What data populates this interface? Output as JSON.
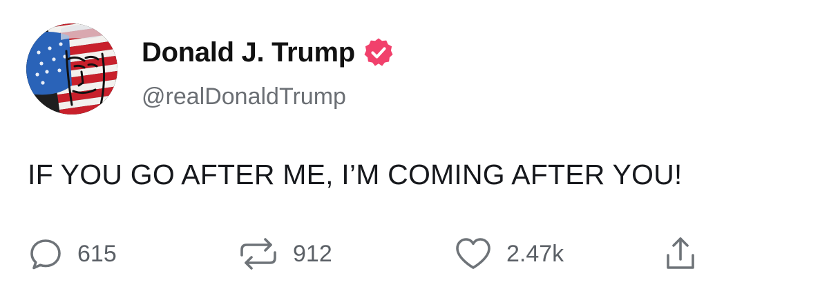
{
  "author": {
    "display_name": "Donald J. Trump",
    "handle": "@realDonaldTrump",
    "verified": true,
    "verified_badge_color": "#f1416c",
    "avatar_icon": "flag-painted-portrait"
  },
  "post": {
    "text": "IF YOU GO AFTER ME, I’M COMING AFTER YOU!"
  },
  "actions": {
    "reply": {
      "icon": "speech-bubble-icon",
      "count": "615"
    },
    "repost": {
      "icon": "repost-arrows-icon",
      "count": "912"
    },
    "like": {
      "icon": "heart-icon",
      "count": "2.47k"
    },
    "share": {
      "icon": "share-upload-icon"
    }
  },
  "colors": {
    "text": "#16181c",
    "muted": "#6b6f74",
    "icon": "#6e7378",
    "background": "#ffffff"
  }
}
